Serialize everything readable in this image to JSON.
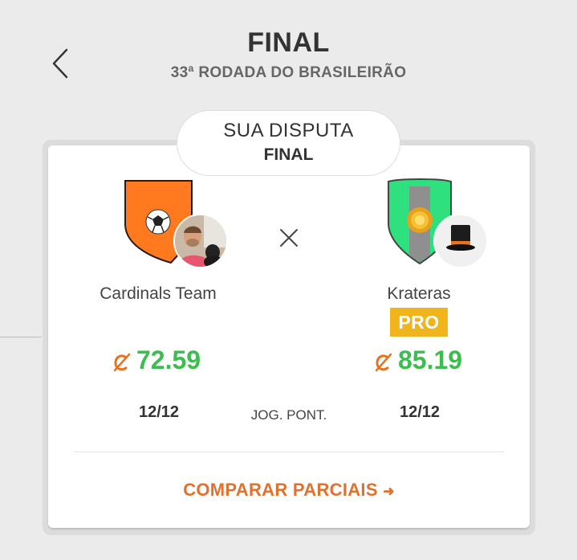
{
  "header": {
    "title": "FINAL",
    "subtitle": "33ª RODADA DO BRASILEIRÃO"
  },
  "dispute": {
    "label": "SUA DISPUTA",
    "phase": "FINAL"
  },
  "vs_icon": "close-x-icon",
  "home_team": {
    "name": "Cardinals Team",
    "shield_icon": "orange-shield-soccer-ball",
    "avatar": "user-photo",
    "score": "72.59",
    "players": "12/12"
  },
  "away_team": {
    "name": "Krateras",
    "badge": "PRO",
    "shield_icon": "green-shield-sun-emblem",
    "avatar": "top-hat-icon",
    "score": "85.19",
    "players": "12/12"
  },
  "players_label": "JOG. PONT.",
  "compare_label": "COMPARAR PARCIAIS",
  "compare_arrow": "➜",
  "colors": {
    "background": "#ebebeb",
    "score_green": "#3dbd4f",
    "accent_orange": "#e0712f",
    "pro_yellow": "#f0b41d",
    "shield_orange": "#ff7a1f",
    "shield_green": "#2fe07f"
  }
}
